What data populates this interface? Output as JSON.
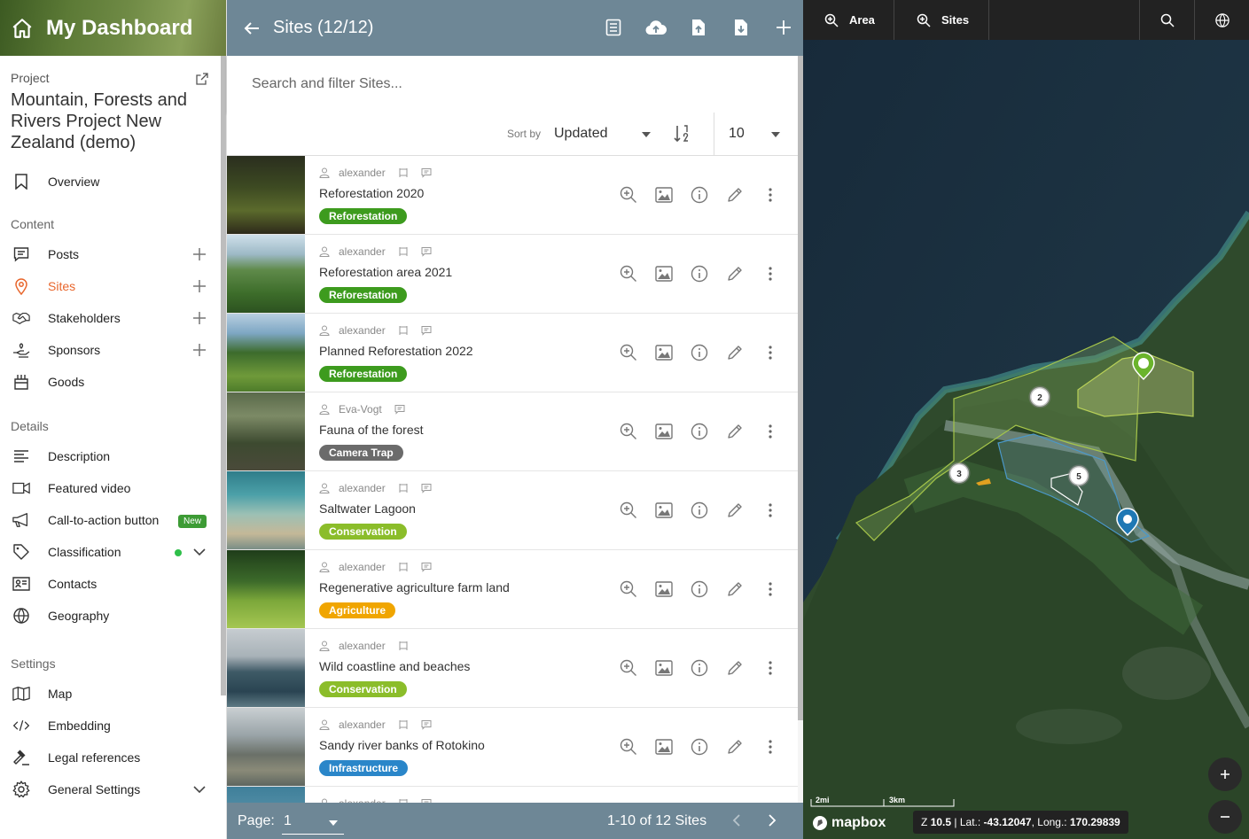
{
  "sidebar": {
    "app_title": "My Dashboard",
    "project_label": "Project",
    "project_name": "Mountain, Forests and Rivers Project New Zealand (demo)",
    "overview": "Overview",
    "content_label": "Content",
    "content_items": [
      "Posts",
      "Sites",
      "Stakeholders",
      "Sponsors",
      "Goods"
    ],
    "details_label": "Details",
    "details_items": [
      "Description",
      "Featured video",
      "Call-to-action button",
      "Classification",
      "Contacts",
      "Geography"
    ],
    "new_badge": "New",
    "settings_label": "Settings",
    "settings_items": [
      "Map",
      "Embedding",
      "Legal references",
      "General Settings"
    ]
  },
  "sites_panel": {
    "title": "Sites (12/12)",
    "search_placeholder": "Search and filter Sites...",
    "sort_by_label": "Sort by",
    "sort_by_value": "Updated",
    "per_page": "10",
    "rows": [
      {
        "author": "alexander",
        "title": "Reforestation 2020",
        "tag": "Reforestation",
        "tag_color": "#3d9b1e"
      },
      {
        "author": "alexander",
        "title": "Reforestation area 2021",
        "tag": "Reforestation",
        "tag_color": "#3d9b1e"
      },
      {
        "author": "alexander",
        "title": "Planned Reforestation 2022",
        "tag": "Reforestation",
        "tag_color": "#3d9b1e"
      },
      {
        "author": "Eva-Vogt",
        "title": "Fauna of the forest",
        "tag": "Camera Trap",
        "tag_color": "#6b6b6b"
      },
      {
        "author": "alexander",
        "title": "Saltwater Lagoon",
        "tag": "Conservation",
        "tag_color": "#8bbd2a"
      },
      {
        "author": "alexander",
        "title": "Regenerative agriculture farm land",
        "tag": "Agriculture",
        "tag_color": "#f0a500"
      },
      {
        "author": "alexander",
        "title": "Wild coastline and beaches",
        "tag": "Conservation",
        "tag_color": "#8bbd2a"
      },
      {
        "author": "alexander",
        "title": "Sandy river banks of Rotokino",
        "tag": "Infrastructure",
        "tag_color": "#2a86c9"
      },
      {
        "author": "alexander"
      }
    ],
    "pager": {
      "page_label": "Page:",
      "page_value": "1",
      "info": "1-10 of 12 Sites"
    }
  },
  "map": {
    "area_btn": "Area",
    "sites_btn": "Sites",
    "clusters": [
      "2",
      "3",
      "5"
    ],
    "scale_mi": "2mi",
    "scale_km": "3km",
    "logo": "mapbox",
    "zoom_prefix": "Z",
    "zoom": "10.5",
    "lat_label": "Lat.:",
    "lat": "-43.12047",
    "long_label": "Long.:",
    "long": "170.29839"
  },
  "colors": {
    "accent": "#e8662c",
    "header_blue": "#6e8796"
  }
}
